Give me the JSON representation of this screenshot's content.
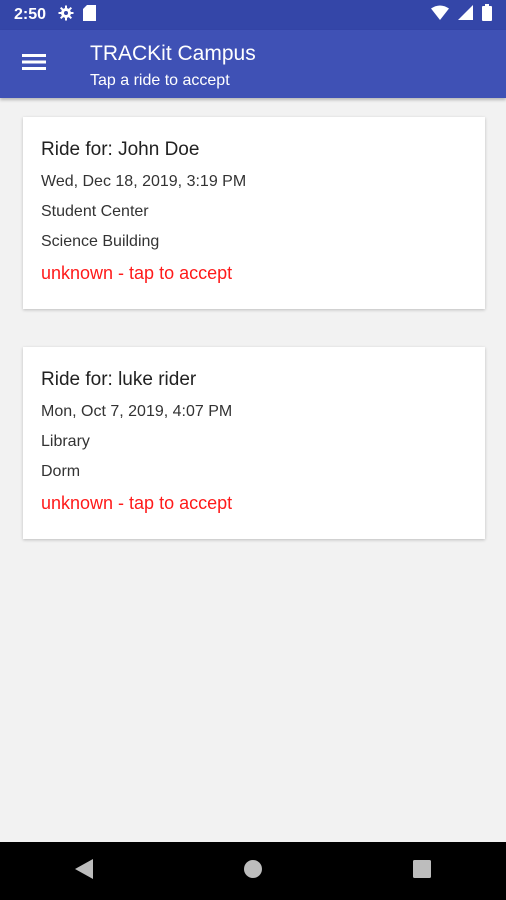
{
  "status_bar": {
    "time": "2:50",
    "left_icons": [
      "gear-icon",
      "sd-card-icon"
    ],
    "right_icons": [
      "wifi-icon",
      "signal-icon",
      "battery-icon"
    ]
  },
  "app_bar": {
    "menu_icon": "hamburger-menu-icon",
    "title": "TRACKit Campus",
    "subtitle": "Tap a ride to accept",
    "color": "#3f51b5"
  },
  "rides": [
    {
      "title": "Ride for: John Doe",
      "date": "Wed, Dec 18, 2019, 3:19 PM",
      "from": "Student Center",
      "to": "Science Building",
      "status": "unknown - tap to accept"
    },
    {
      "title": "Ride for: luke rider",
      "date": "Mon, Oct 7, 2019, 4:07 PM",
      "from": "Library",
      "to": "Dorm",
      "status": "unknown - tap to accept"
    }
  ],
  "colors": {
    "status_text": "#ff1a1a",
    "status_bar": "#3446a8",
    "background": "#f2f2f2"
  },
  "nav_bar": {
    "buttons": [
      "back-icon",
      "home-icon",
      "recents-icon"
    ]
  }
}
